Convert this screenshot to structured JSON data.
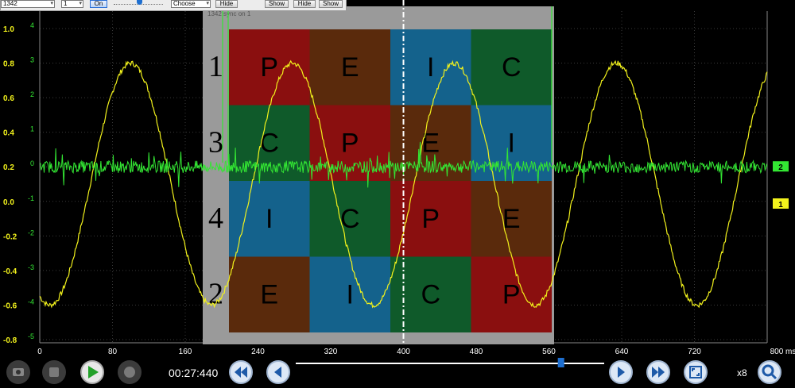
{
  "toolbar": {
    "select1": "1342",
    "select2": "1",
    "on_button": "On",
    "channel_select": "Choose",
    "hide1": "Hide",
    "show1": "Show",
    "hide2": "Hide",
    "show2": "Show"
  },
  "ghost_window": {
    "title": "1342 sync on 1",
    "row_numbers": [
      "1",
      "3",
      "4",
      "2"
    ],
    "grid": [
      [
        {
          "letter": "P",
          "color": "#8a0f0f"
        },
        {
          "letter": "E",
          "color": "#5a2a0c"
        },
        {
          "letter": "I",
          "color": "#14628c"
        },
        {
          "letter": "C",
          "color": "#0f5a2a"
        }
      ],
      [
        {
          "letter": "C",
          "color": "#0f5a2a"
        },
        {
          "letter": "P",
          "color": "#8a0f0f"
        },
        {
          "letter": "E",
          "color": "#5a2a0c"
        },
        {
          "letter": "I",
          "color": "#14628c"
        }
      ],
      [
        {
          "letter": "I",
          "color": "#14628c"
        },
        {
          "letter": "C",
          "color": "#0f5a2a"
        },
        {
          "letter": "P",
          "color": "#8a0f0f"
        },
        {
          "letter": "E",
          "color": "#5a2a0c"
        }
      ],
      [
        {
          "letter": "E",
          "color": "#5a2a0c"
        },
        {
          "letter": "I",
          "color": "#14628c"
        },
        {
          "letter": "C",
          "color": "#0f5a2a"
        },
        {
          "letter": "P",
          "color": "#8a0f0f"
        }
      ]
    ]
  },
  "scope": {
    "left_axis_labels": [
      "1.0",
      "0.8",
      "0.6",
      "0.4",
      "0.2",
      "0.0",
      "-0.2",
      "-0.4",
      "-0.6",
      "-0.8"
    ],
    "right_axis_labels": [
      "4",
      "3",
      "2",
      "1",
      "0",
      "-1",
      "-2",
      "-3",
      "-4",
      "-5"
    ],
    "x_axis_labels": [
      "0",
      "80",
      "160",
      "240",
      "320",
      "400",
      "480",
      "560",
      "640",
      "720",
      "800 ms"
    ],
    "channel_markers": [
      "2",
      "1"
    ],
    "colors": {
      "ch1": "#f2f21c",
      "ch2": "#33e633",
      "background": "#000000",
      "grid": "#3a3a3a"
    }
  },
  "chart_data": {
    "type": "line",
    "xlabel": "ms",
    "xlim": [
      0,
      800
    ],
    "series": [
      {
        "name": "1",
        "color": "#f2f21c",
        "shape": "sine",
        "period_ms": 178,
        "axis_min": -0.8,
        "axis_max": 1.0,
        "peak": 0.8,
        "trough": -0.6,
        "peak_ms": [
          100,
          280,
          458,
          640,
          820
        ]
      },
      {
        "name": "2",
        "color": "#33e633",
        "shape": "noise-flat",
        "axis_min": -5,
        "axis_max": 4,
        "level": 0
      }
    ]
  },
  "transport": {
    "time": "00:27:440",
    "zoom": "x8",
    "slider_percent": 86
  }
}
